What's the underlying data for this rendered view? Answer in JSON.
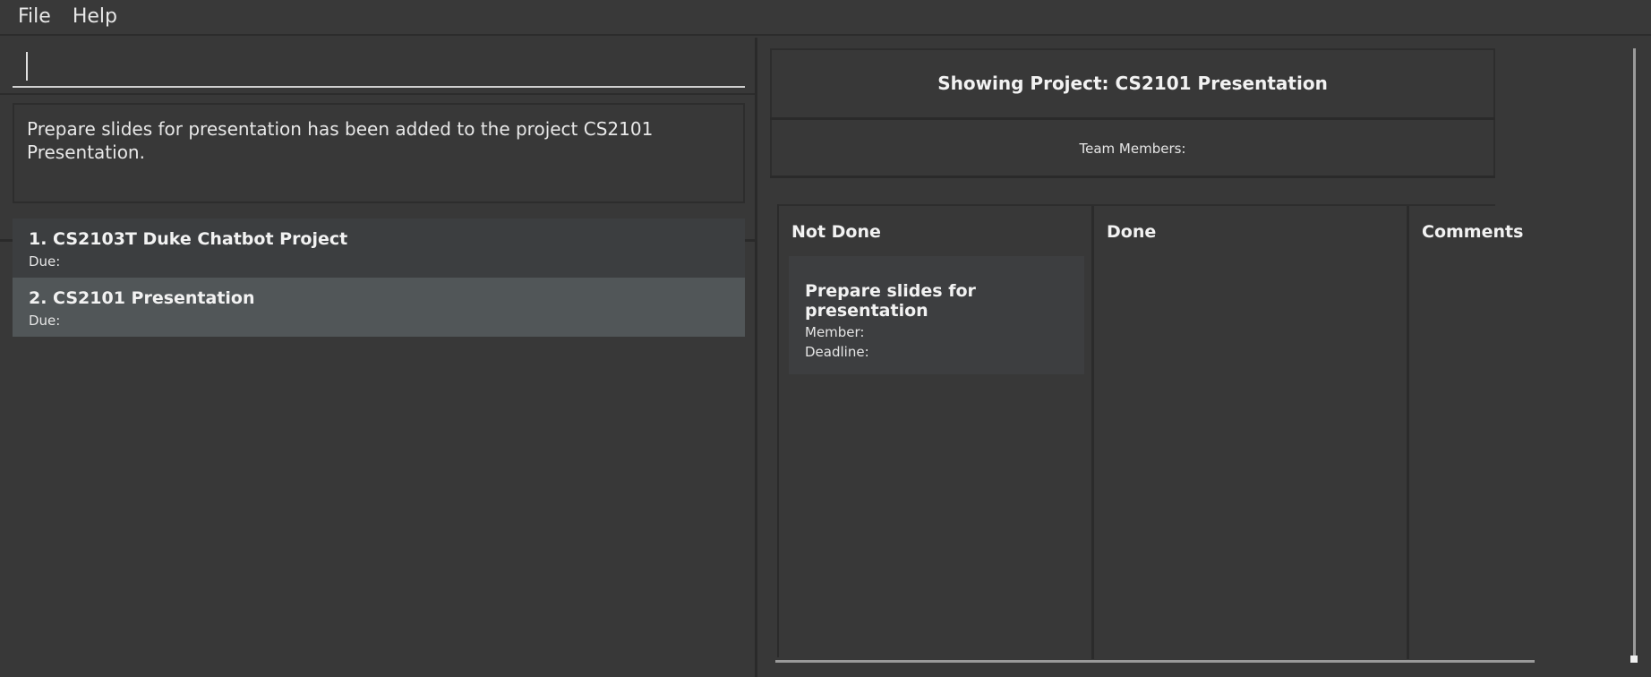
{
  "menu": {
    "file": "File",
    "help": "Help"
  },
  "command": {
    "value": "",
    "placeholder": ""
  },
  "result": {
    "message": "Prepare slides for presentation has been added to the project CS2101 Presentation."
  },
  "projects": [
    {
      "title": "1.  CS2103T Duke Chatbot Project",
      "due": "Due:"
    },
    {
      "title": "2.  CS2101 Presentation",
      "due": "Due:"
    }
  ],
  "project_view": {
    "title": "Showing Project: CS2101 Presentation",
    "team_members": "Team Members:",
    "columns": {
      "not_done": "Not Done",
      "done": "Done",
      "comments": "Comments"
    },
    "tasks": [
      {
        "title": "Prepare slides for presentation",
        "member": "Member:",
        "deadline": "Deadline:"
      }
    ]
  }
}
